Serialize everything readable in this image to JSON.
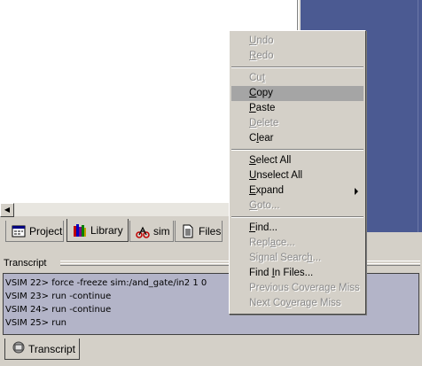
{
  "tabs": [
    {
      "label": "Project",
      "icon": "project-icon"
    },
    {
      "label": "Library",
      "icon": "library-icon"
    },
    {
      "label": "sim",
      "icon": "sim-icon"
    },
    {
      "label": "Files",
      "icon": "files-icon"
    }
  ],
  "transcript": {
    "title": "Transcript",
    "lines": [
      "VSIM 22> force -freeze sim:/and_gate/in2 1 0",
      "VSIM 23> run -continue",
      "VSIM 24> run -continue",
      "VSIM 25> run"
    ],
    "bottom_tab": "Transcript"
  },
  "context_menu": {
    "groups": [
      [
        {
          "label": "Undo",
          "enabled": false
        },
        {
          "label": "Redo",
          "enabled": false
        }
      ],
      [
        {
          "label": "Cut",
          "enabled": false
        },
        {
          "label": "Copy",
          "enabled": true,
          "highlighted": true
        },
        {
          "label": "Paste",
          "enabled": true
        },
        {
          "label": "Delete",
          "enabled": false
        },
        {
          "label": "Clear",
          "enabled": true
        }
      ],
      [
        {
          "label": "Select All",
          "enabled": true
        },
        {
          "label": "Unselect All",
          "enabled": true
        },
        {
          "label": "Expand",
          "enabled": true,
          "submenu": true
        },
        {
          "label": "Goto...",
          "enabled": false
        }
      ],
      [
        {
          "label": "Find...",
          "enabled": true
        },
        {
          "label": "Replace...",
          "enabled": false
        },
        {
          "label": "Signal Search...",
          "enabled": false
        },
        {
          "label": "Find In Files...",
          "enabled": true
        },
        {
          "label": "Previous Coverage Miss",
          "enabled": false
        },
        {
          "label": "Next Coverage Miss",
          "enabled": false
        }
      ]
    ]
  },
  "colors": {
    "background": "#d4d0c8",
    "blue_pane": "#4b5a92",
    "transcript_bg": "#b3b4c8",
    "menu_highlight": "#a5a5a5"
  }
}
